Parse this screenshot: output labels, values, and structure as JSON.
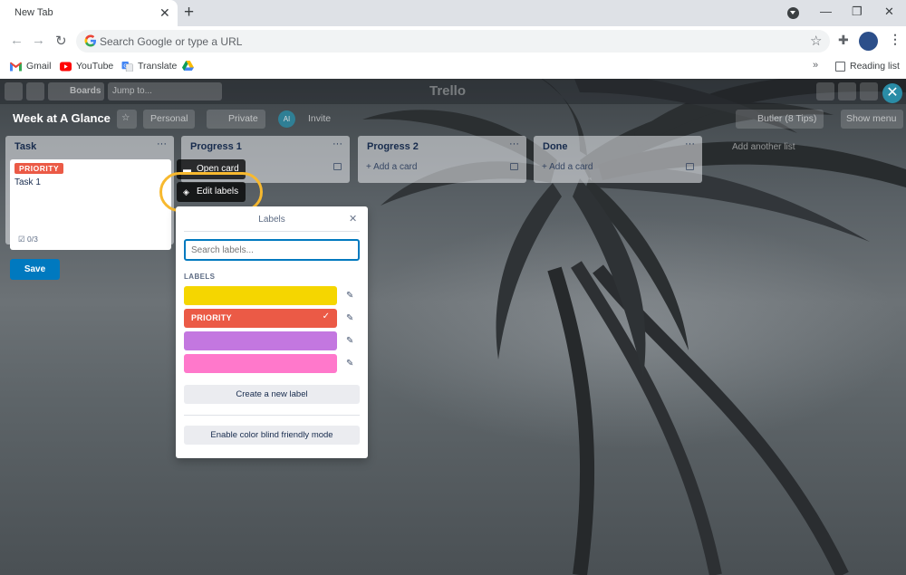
{
  "browser": {
    "tab_title": "New Tab",
    "omnibox_placeholder": "Search Google or type a URL",
    "bookmarks": [
      {
        "label": "Gmail",
        "icon": "gmail-icon"
      },
      {
        "label": "YouTube",
        "icon": "youtube-icon"
      },
      {
        "label": "Translate",
        "icon": "translate-icon"
      },
      {
        "label": "",
        "icon": "drive-icon"
      }
    ],
    "reading_list": "Reading list"
  },
  "trello": {
    "header": {
      "boards_label": "Boards",
      "jump_to_placeholder": "Jump to...",
      "logo": "Trello"
    },
    "board": {
      "title": "Week at A Glance",
      "workspace": "Personal",
      "visibility": "Private",
      "member_initials": "AI",
      "invite": "Invite",
      "butler": "Butler (8 Tips)",
      "show_menu": "Show menu"
    },
    "lists": [
      {
        "title": "Task",
        "add_card": ""
      },
      {
        "title": "Progress 1",
        "add_card": "Add a card"
      },
      {
        "title": "Progress 2",
        "add_card": "Add a card"
      },
      {
        "title": "Done",
        "add_card": "Add a card"
      }
    ],
    "add_another_list": "Add another list",
    "editing_card": {
      "label": "PRIORITY",
      "name": "Task 1",
      "checklist": "0/3",
      "save": "Save"
    },
    "quick_actions": {
      "open_card": "Open card",
      "edit_labels": "Edit labels"
    },
    "labels_popover": {
      "title": "Labels",
      "search_placeholder": "Search labels...",
      "section_title": "LABELS",
      "labels": [
        {
          "name": "",
          "color": "#f5d600",
          "checked": false
        },
        {
          "name": "PRIORITY",
          "color": "#eb5a46",
          "checked": true
        },
        {
          "name": "",
          "color": "#c377e0",
          "checked": false
        },
        {
          "name": "",
          "color": "#ff78cb",
          "checked": false
        }
      ],
      "create_label": "Create a new label",
      "color_blind": "Enable color blind friendly mode"
    }
  },
  "colors": {
    "accent": "#0079bf",
    "highlight": "#f7b92f"
  }
}
